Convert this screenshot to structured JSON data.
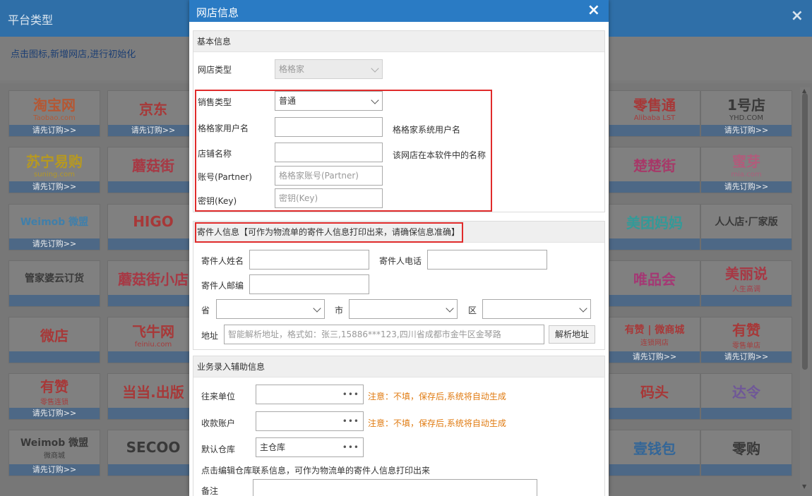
{
  "background": {
    "title": "平台类型",
    "close": "×",
    "hint": "点击图标,新增网店,进行初始化",
    "tiles": [
      {
        "name": "taobao",
        "logo": "淘宝网",
        "sub": "Taobao.com",
        "color": "#c74a1a",
        "foot": "请先订购>>"
      },
      {
        "name": "jd",
        "logo": "京东",
        "sub": "",
        "color": "#b52020",
        "foot": "请先订购>>"
      },
      {
        "name": "lst",
        "logo": "零售通",
        "sub": "Alibaba LST",
        "color": "#b52020",
        "foot": ""
      },
      {
        "name": "yhd",
        "logo": "1号店",
        "sub": "YHD.COM",
        "color": "#222",
        "foot": "请先订购>>"
      },
      {
        "name": "suning",
        "logo": "苏宁易购",
        "sub": "suning.com",
        "color": "#caa200",
        "foot": "请先订购>>"
      },
      {
        "name": "mogujie",
        "logo": "蘑菇街",
        "sub": "",
        "color": "#b52030",
        "foot": ""
      },
      {
        "name": "chuchujie",
        "logo": "楚楚街",
        "sub": "",
        "color": "#b52060",
        "foot": ""
      },
      {
        "name": "mia",
        "logo": "蜜芽",
        "sub": "mia.com",
        "color": "#c0507a",
        "foot": "请先订购>>"
      },
      {
        "name": "weimob",
        "logo": "Weimob 微盟",
        "sub": "",
        "color": "#2b7fb8",
        "foot": "请先订购>>"
      },
      {
        "name": "higo",
        "logo": "HIGO",
        "sub": "",
        "color": "#b52020",
        "foot": ""
      },
      {
        "name": "meituan",
        "logo": "美团妈妈",
        "sub": "",
        "color": "#1aa3a0",
        "foot": ""
      },
      {
        "name": "renrendian",
        "logo": "人人店·厂家版",
        "sub": "",
        "color": "#222",
        "foot": ""
      },
      {
        "name": "guanjiapo",
        "logo": "管家婆云订货",
        "sub": "",
        "color": "#222",
        "foot": ""
      },
      {
        "name": "mogujie-xiaodian",
        "logo": "蘑菇街小店",
        "sub": "",
        "color": "#b52030",
        "foot": ""
      },
      {
        "name": "vip",
        "logo": "唯品会",
        "sub": "",
        "color": "#b02070",
        "foot": ""
      },
      {
        "name": "meilishuo",
        "logo": "美丽说",
        "sub": "人生高调",
        "color": "#b52030",
        "foot": ""
      },
      {
        "name": "weidian",
        "logo": "微店",
        "sub": "",
        "color": "#b52020",
        "foot": ""
      },
      {
        "name": "feiniu",
        "logo": "飞牛网",
        "sub": "feiniu.com",
        "color": "#b52020",
        "foot": ""
      },
      {
        "name": "youzan-chain",
        "logo": "有赞 | 微商城",
        "sub": "连锁网店",
        "color": "#b52020",
        "foot": "请先订购>>"
      },
      {
        "name": "youzan-retail",
        "logo": "有赞",
        "sub": "零售单店",
        "color": "#b52020",
        "foot": "请先订购>>"
      },
      {
        "name": "youzan-retail-chain",
        "logo": "有赞",
        "sub": "零售连锁",
        "color": "#b52020",
        "foot": "请先订购>>"
      },
      {
        "name": "dangdang",
        "logo": "当当.出版",
        "sub": "",
        "color": "#b52020",
        "foot": ""
      },
      {
        "name": "matou",
        "logo": "码头",
        "sub": "",
        "color": "#b52020",
        "foot": ""
      },
      {
        "name": "daling",
        "logo": "达令",
        "sub": "",
        "color": "#6a4aa0",
        "foot": ""
      },
      {
        "name": "weimob-mall",
        "logo": "Weimob 微盟",
        "sub": "微商城",
        "color": "#222",
        "foot": "请先订购>>"
      },
      {
        "name": "secoo",
        "logo": "SECOO",
        "sub": "",
        "color": "#222",
        "foot": ""
      },
      {
        "name": "yiqianbao",
        "logo": "壹钱包",
        "sub": "",
        "color": "#1a5ea0",
        "foot": ""
      },
      {
        "name": "linggou",
        "logo": "零购",
        "sub": "",
        "color": "#222",
        "foot": ""
      }
    ]
  },
  "modal": {
    "title": "网店信息",
    "close": "×",
    "basic": {
      "head": "基本信息",
      "shop_type_label": "网店类型",
      "shop_type_value": "格格家",
      "sales_type_label": "销售类型",
      "sales_type_value": "普通",
      "username_label": "格格家用户名",
      "username_hint": "格格家系统用户名",
      "shopname_label": "店铺名称",
      "shopname_hint": "该网店在本软件中的名称",
      "partner_label": "账号(Partner)",
      "partner_placeholder": "格格家账号(Partner)",
      "key_label": "密钥(Key)",
      "key_placeholder": "密钥(Key)"
    },
    "sender": {
      "head": "寄件人信息【可作为物流单的寄件人信息打印出来，请确保信息准确】",
      "name_label": "寄件人姓名",
      "phone_label": "寄件人电话",
      "zip_label": "寄件人邮编",
      "province_label": "省",
      "city_label": "市",
      "district_label": "区",
      "address_label": "地址",
      "address_placeholder": "智能解析地址，格式如：张三,15886***123,四川省成都市金牛区金琴路",
      "parse_button": "解析地址"
    },
    "business": {
      "head": "业务录入辅助信息",
      "partner_unit_label": "往来单位",
      "partner_unit_note": "注意：不填，保存后,系统将自动生成",
      "account_label": "收款账户",
      "account_note": "注意：不填，保存后,系统将自动生成",
      "warehouse_label": "默认仓库",
      "warehouse_value": "主仓库",
      "warehouse_hint": "点击编辑仓库联系信息，可作为物流单的寄件人信息打印出来",
      "remark_label": "备注"
    },
    "dots": "•••"
  }
}
